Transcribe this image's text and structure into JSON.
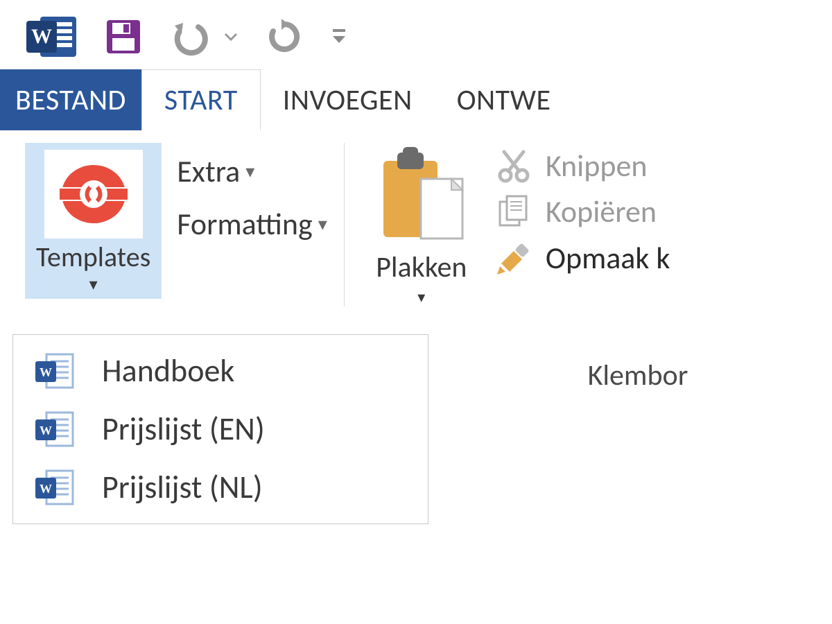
{
  "tabs": {
    "file": "BESTAND",
    "start": "START",
    "insert": "INVOEGEN",
    "design": "ONTWE"
  },
  "ribbon": {
    "templates": {
      "label": "Templates",
      "items": [
        "Handboek",
        "Prijslijst (EN)",
        "Prijslijst (NL)"
      ]
    },
    "extra": "Extra",
    "formatting": "Formatting",
    "paste": "Plakken",
    "cut": "Knippen",
    "copy": "Kopiëren",
    "formatPainter": "Opmaak k",
    "clipboardGroup": "Klembor"
  },
  "colors": {
    "brand": "#2b579a",
    "accent": "#7b2f8f"
  }
}
